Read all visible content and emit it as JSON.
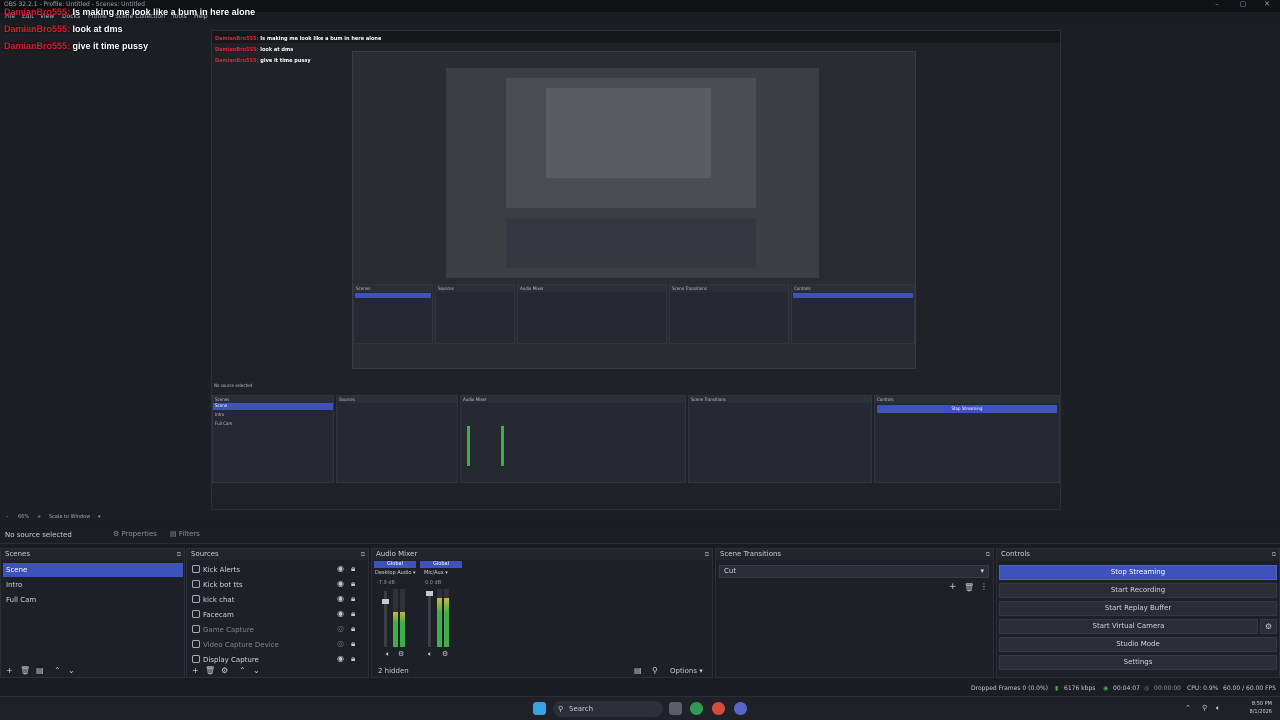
{
  "window": {
    "title": "OBS 32.2.1 - Profile: Untitled - Scenes: Untitled"
  },
  "menu": [
    "File",
    "Edit",
    "View",
    "Docks",
    "Profile",
    "Scene Collection",
    "Tools",
    "Help"
  ],
  "chat": [
    {
      "user": "DamianBro555:",
      "text": "Is making me look like a bum in here alone"
    },
    {
      "user": "DamianBro555:",
      "text": "look at dms"
    },
    {
      "user": "DamianBro555:",
      "text": "give it time pussy"
    }
  ],
  "preview": {
    "zoom": "66%",
    "scale_mode": "Scale to Window"
  },
  "properties_bar": {
    "no_source": "No source selected",
    "properties": "Properties",
    "filters": "Filters"
  },
  "scenes": {
    "title": "Scenes",
    "items": [
      "Scene",
      "Intro",
      "Full Cam"
    ],
    "selected": 0
  },
  "sources": {
    "title": "Sources",
    "items": [
      {
        "name": "Kick Alerts",
        "dim": false
      },
      {
        "name": "Kick bot tts",
        "dim": false
      },
      {
        "name": "kick chat",
        "dim": false
      },
      {
        "name": "Facecam",
        "dim": false
      },
      {
        "name": "Game Capture",
        "dim": true
      },
      {
        "name": "Video Capture Device",
        "dim": true
      },
      {
        "name": "Display Capture",
        "dim": false
      }
    ]
  },
  "audio_mixer": {
    "title": "Audio Mixer",
    "channels": [
      {
        "badge": "Global",
        "name": "Desktop Audio",
        "db": "-7.9 dB",
        "level": 0.6
      },
      {
        "badge": "Global",
        "name": "Mic/Aux",
        "db": "0.0 dB",
        "level": 0.85
      }
    ],
    "hidden": "2 hidden",
    "options": "Options"
  },
  "scene_transitions": {
    "title": "Scene Transitions",
    "selected": "Cut"
  },
  "controls": {
    "title": "Controls",
    "buttons": [
      "Stop Streaming",
      "Start Recording",
      "Start Replay Buffer",
      "Start Virtual Camera",
      "Studio Mode",
      "Settings"
    ]
  },
  "status": {
    "dropped": "Dropped Frames 0 (0.0%)",
    "bitrate": "6176 kbps",
    "stream_time": "00:04:07",
    "rec_time": "00:00:00",
    "cpu": "CPU: 0.9%",
    "fps": "60.00 / 60.00 FPS"
  },
  "taskbar": {
    "search": "Search",
    "time": "8:50 PM",
    "date": "8/1/2026"
  },
  "colors": {
    "accent": "#3d52bb",
    "username": "#d61f2c",
    "meter_green": "#3fae4a",
    "meter_yellow": "#c9b93a"
  }
}
